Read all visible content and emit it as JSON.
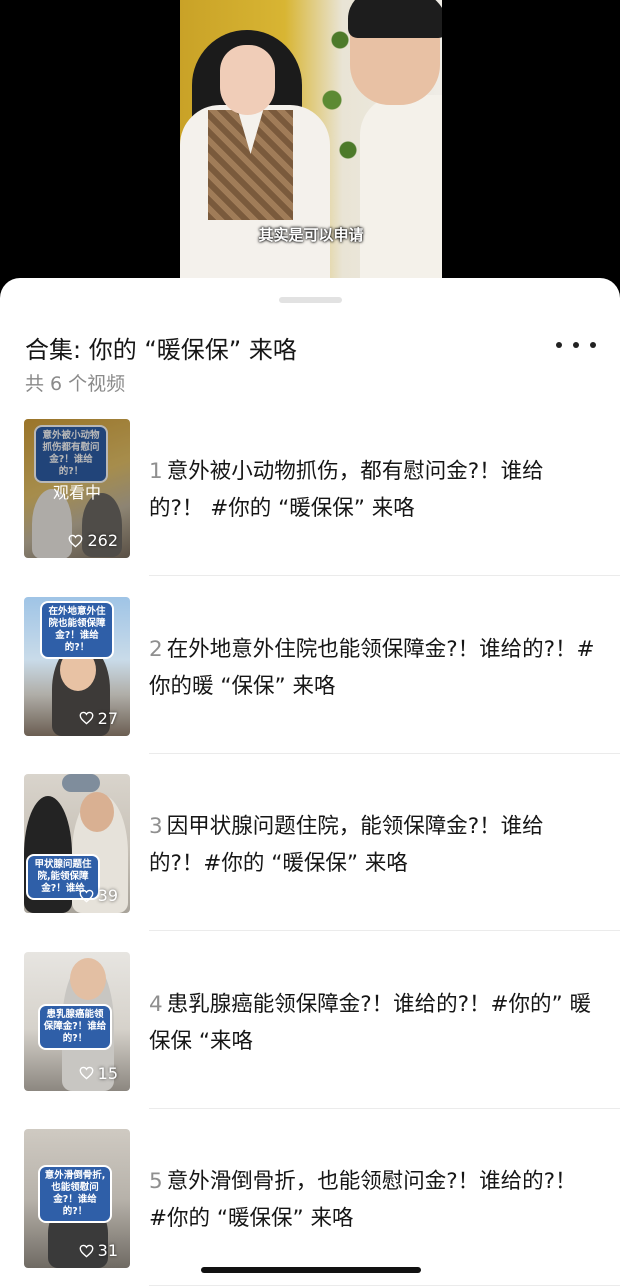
{
  "video": {
    "subtitle": "其实是可以申请"
  },
  "collection": {
    "title": "合集: 你的 “暖保保” 来咯",
    "count": "共 6 个视频",
    "more_icon": "more-horizontal-icon"
  },
  "items": [
    {
      "number": "1",
      "title": "意外被小动物抓伤，都有慰问金?！谁给的?！ #你的 “暖保保” 来咯",
      "thumb_text": "意外被小动物抓伤都有慰问金?！谁给的?！",
      "watching": "观看中",
      "likes": "262"
    },
    {
      "number": "2",
      "title": "在外地意外住院也能领保障金?！谁给的?！#你的暖 “保保” 来咯",
      "thumb_text": "在外地意外住院也能领保障金?！谁给的?！",
      "likes": "27"
    },
    {
      "number": "3",
      "title": "因甲状腺问题住院，能领保障金?！谁给的?！#你的 “暖保保” 来咯",
      "thumb_text": "甲状腺问题住院,能领保障金?！谁给",
      "likes": "39"
    },
    {
      "number": "4",
      "title": "患乳腺癌能领保障金?！谁给的?！#你的” 暖保保 “来咯",
      "thumb_text": "患乳腺癌能领保障金?！谁给的?！",
      "likes": "15"
    },
    {
      "number": "5",
      "title": "意外滑倒骨折，也能领慰问金?！谁给的?！ #你的 “暖保保” 来咯",
      "thumb_text": "意外滑倒骨折,也能领慰问金?！谁给的?！",
      "likes": "31"
    }
  ]
}
